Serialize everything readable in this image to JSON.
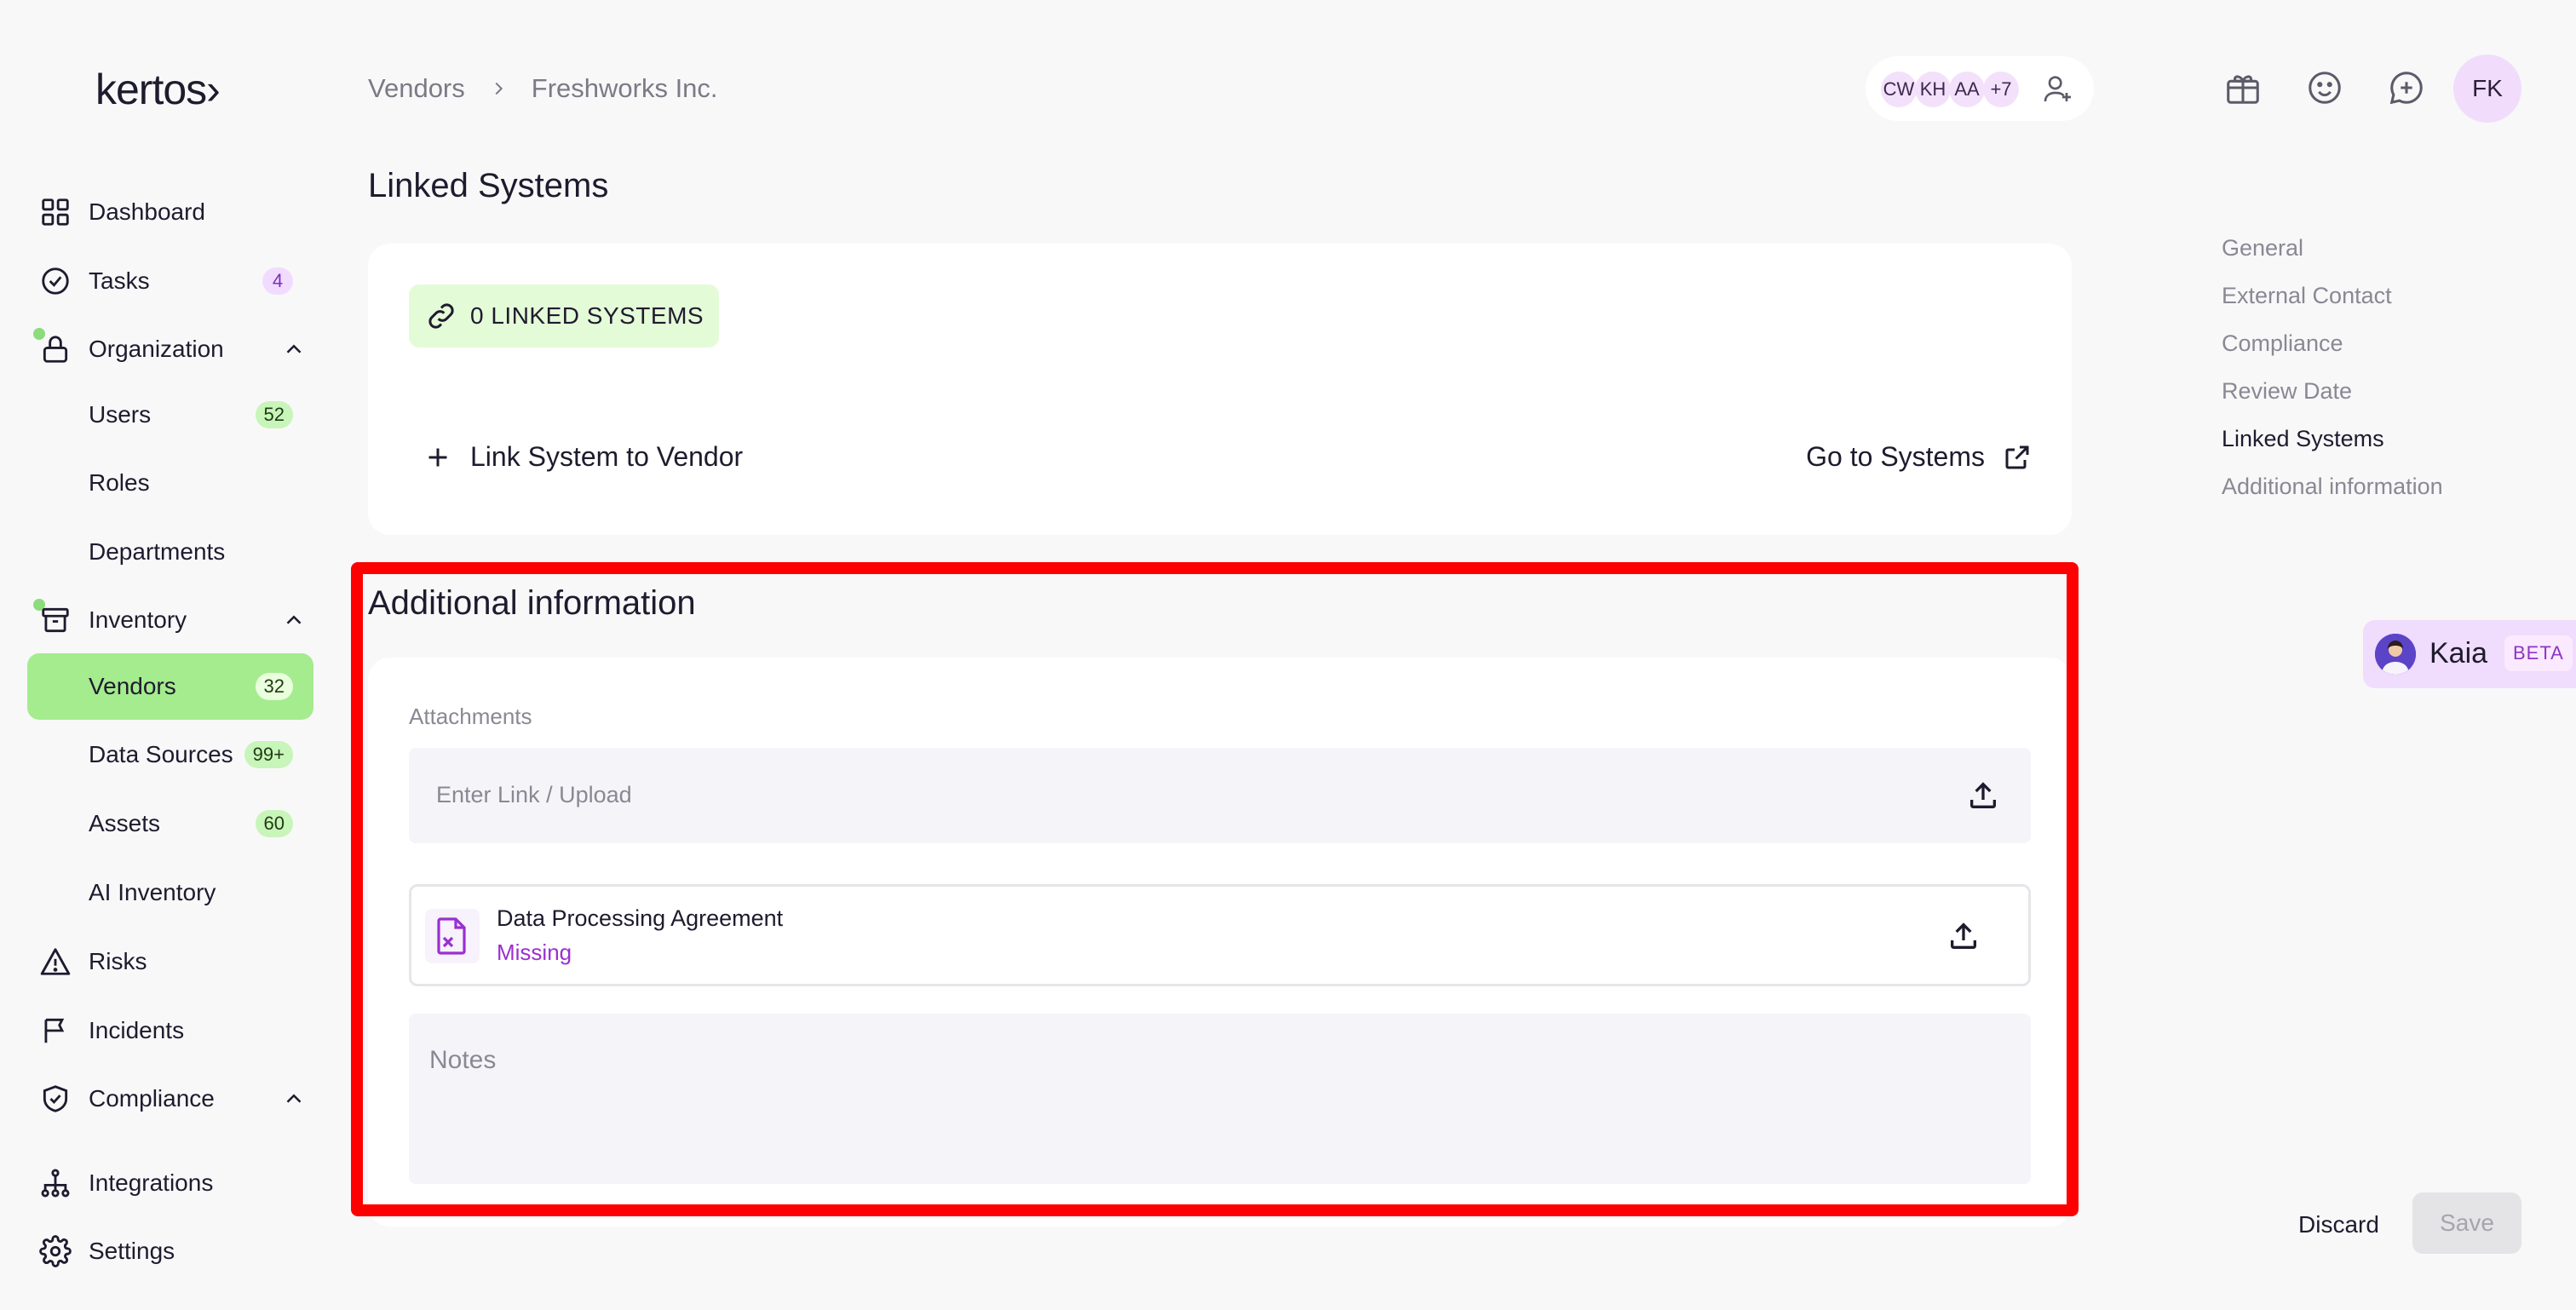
{
  "app": {
    "logo": "kertos›"
  },
  "breadcrumb": {
    "parent": "Vendors",
    "current": "Freshworks Inc."
  },
  "header": {
    "collaborators": [
      "CW",
      "KH",
      "AA",
      "+7"
    ],
    "user_initials": "FK"
  },
  "sidebar": {
    "items": [
      {
        "label": "Dashboard"
      },
      {
        "label": "Tasks",
        "badge": "4"
      },
      {
        "label": "Organization"
      },
      {
        "label": "Users",
        "badge": "52"
      },
      {
        "label": "Roles"
      },
      {
        "label": "Departments"
      },
      {
        "label": "Inventory"
      },
      {
        "label": "Vendors",
        "badge": "32"
      },
      {
        "label": "Data Sources",
        "badge": "99+"
      },
      {
        "label": "Assets",
        "badge": "60"
      },
      {
        "label": "AI Inventory"
      },
      {
        "label": "Risks"
      },
      {
        "label": "Incidents"
      },
      {
        "label": "Compliance"
      },
      {
        "label": "Integrations"
      },
      {
        "label": "Settings"
      }
    ]
  },
  "linked_systems": {
    "title": "Linked Systems",
    "count_label": "0 LINKED SYSTEMS",
    "link_action": "Link System to Vendor",
    "goto_action": "Go to Systems"
  },
  "additional_info": {
    "title": "Additional information",
    "attachments_label": "Attachments",
    "attachments_placeholder": "Enter Link / Upload",
    "document": {
      "title": "Data Processing Agreement",
      "status": "Missing"
    },
    "notes_placeholder": "Notes"
  },
  "toc": {
    "items": [
      "General",
      "External Contact",
      "Compliance",
      "Review Date",
      "Linked Systems",
      "Additional information"
    ],
    "active": "Linked Systems"
  },
  "assistant": {
    "name": "Kaia",
    "badge": "BETA"
  },
  "footer": {
    "discard": "Discard",
    "save": "Save"
  },
  "colors": {
    "accent_green": "#a4ec8e",
    "missing_purple": "#9b2fd0",
    "highlight_red": "#ff0000"
  }
}
